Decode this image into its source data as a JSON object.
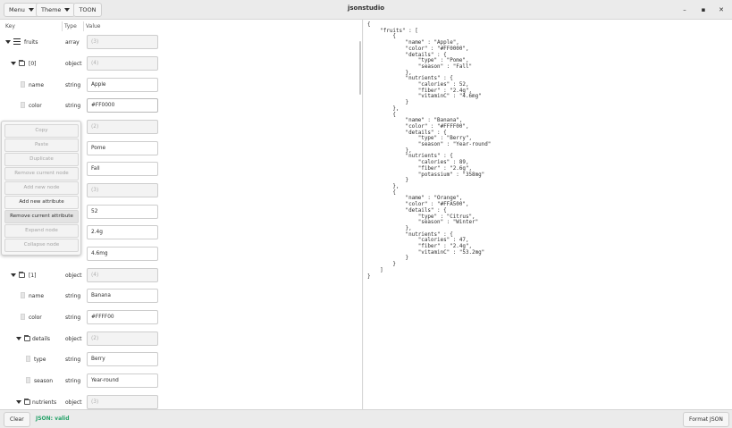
{
  "window": {
    "title": "jsonstudio",
    "minimize_icon": "minimize-icon",
    "maximize_icon": "maximize-icon",
    "close_icon": "close-icon"
  },
  "toolbar": {
    "menu_label": "Menu",
    "theme_label": "Theme",
    "toon_label": "TOON"
  },
  "tree": {
    "columns": {
      "key": "Key",
      "type": "Type",
      "value": "Value"
    },
    "rows": [
      {
        "key": "fruits",
        "type": "array",
        "value": "(3)",
        "placeholder": true
      },
      {
        "key": "[0]",
        "type": "object",
        "value": "(4)",
        "placeholder": true
      },
      {
        "key": "name",
        "type": "string",
        "value": "Apple",
        "placeholder": false
      },
      {
        "key": "color",
        "type": "string",
        "value": "#FF0000",
        "placeholder": false
      },
      {
        "key": "",
        "type": "",
        "value": "(2)",
        "placeholder": true
      },
      {
        "key": "",
        "type": "",
        "value": "Pome",
        "placeholder": false
      },
      {
        "key": "",
        "type": "",
        "value": "Fall",
        "placeholder": false
      },
      {
        "key": "",
        "type": "",
        "value": "(3)",
        "placeholder": true
      },
      {
        "key": "",
        "type": "",
        "value": "52",
        "placeholder": false
      },
      {
        "key": "",
        "type": "",
        "value": "2.4g",
        "placeholder": false
      },
      {
        "key": "",
        "type": "",
        "value": "4.6mg",
        "placeholder": false
      },
      {
        "key": "[1]",
        "type": "object",
        "value": "(4)",
        "placeholder": true
      },
      {
        "key": "name",
        "type": "string",
        "value": "Banana",
        "placeholder": false
      },
      {
        "key": "color",
        "type": "string",
        "value": "#FFFF00",
        "placeholder": false
      },
      {
        "key": "details",
        "type": "object",
        "value": "(2)",
        "placeholder": true
      },
      {
        "key": "type",
        "type": "string",
        "value": "Berry",
        "placeholder": false
      },
      {
        "key": "season",
        "type": "string",
        "value": "Year-round",
        "placeholder": false
      },
      {
        "key": "nutrients",
        "type": "object",
        "value": "(3)",
        "placeholder": true
      }
    ]
  },
  "context_menu": {
    "items": [
      {
        "label": "Copy",
        "enabled": false
      },
      {
        "label": "Paste",
        "enabled": false
      },
      {
        "label": "Duplicate",
        "enabled": false
      },
      {
        "label": "Remove current node",
        "enabled": false
      },
      {
        "label": "Add new node",
        "enabled": false
      },
      {
        "label": "Add new attribute",
        "enabled": true
      },
      {
        "label": "Remove current attribute",
        "enabled": true,
        "highlighted": true
      },
      {
        "label": "Expand node",
        "enabled": false
      },
      {
        "label": "Collapse node",
        "enabled": false
      }
    ]
  },
  "json_text": "{\n    \"fruits\" : [\n        {\n            \"name\" : \"Apple\",\n            \"color\" : \"#FF0000\",\n            \"details\" : {\n                \"type\" : \"Pome\",\n                \"season\" : \"Fall\"\n            },\n            \"nutrients\" : {\n                \"calories\" : 52,\n                \"fiber\" : \"2.4g\",\n                \"vitaminC\" : \"4.6mg\"\n            }\n        },\n        {\n            \"name\" : \"Banana\",\n            \"color\" : \"#FFFF00\",\n            \"details\" : {\n                \"type\" : \"Berry\",\n                \"season\" : \"Year-round\"\n            },\n            \"nutrients\" : {\n                \"calories\" : 89,\n                \"fiber\" : \"2.6g\",\n                \"potassium\" : \"358mg\"\n            }\n        },\n        {\n            \"name\" : \"Orange\",\n            \"color\" : \"#FFA500\",\n            \"details\" : {\n                \"type\" : \"Citrus\",\n                \"season\" : \"Winter\"\n            },\n            \"nutrients\" : {\n                \"calories\" : 47,\n                \"fiber\" : \"2.4g\",\n                \"vitaminC\" : \"53.2mg\"\n            }\n        }\n    ]\n}",
  "bottom": {
    "clear_label": "Clear",
    "status": "JSON: valid",
    "status_color": "#26a269",
    "format_label": "Format JSON"
  }
}
